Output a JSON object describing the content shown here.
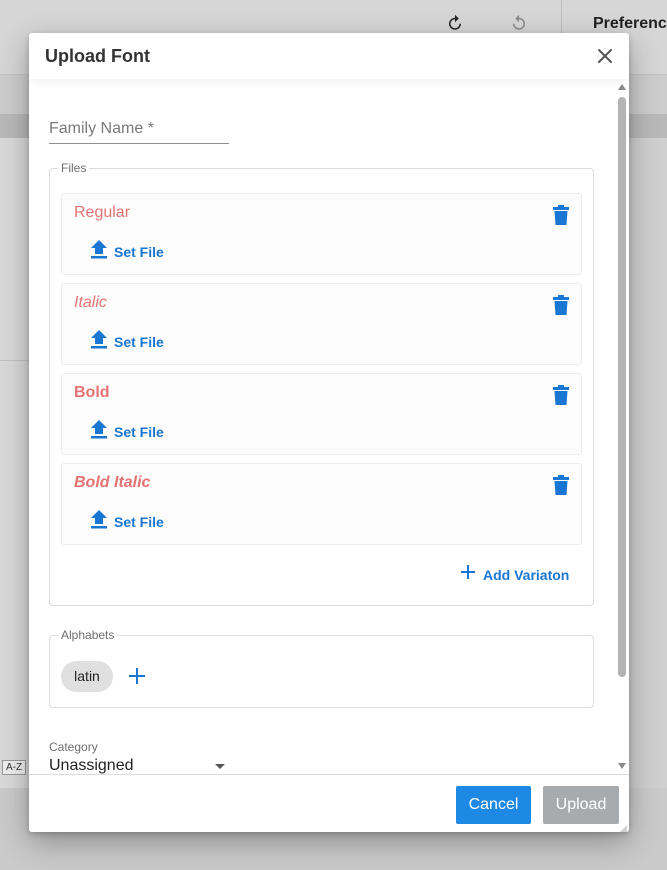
{
  "background": {
    "preferences_label": "Preference",
    "az_label": "A-Z",
    "icons": [
      "undo-icon",
      "redo-icon"
    ]
  },
  "dialog": {
    "title": "Upload Font",
    "family_name": {
      "label": "Family Name *",
      "value": ""
    },
    "files": {
      "legend": "Files",
      "variants": [
        {
          "label": "Regular",
          "style": "regular",
          "action": "Set File"
        },
        {
          "label": "Italic",
          "style": "italic",
          "action": "Set File"
        },
        {
          "label": "Bold",
          "style": "bold",
          "action": "Set File"
        },
        {
          "label": "Bold Italic",
          "style": "bold-italic",
          "action": "Set File"
        }
      ],
      "add_variation_label": "Add Variaton"
    },
    "alphabets": {
      "legend": "Alphabets",
      "chips": [
        "latin"
      ]
    },
    "category": {
      "label": "Category",
      "value": "Unassigned"
    },
    "buttons": {
      "cancel": "Cancel",
      "upload": "Upload"
    }
  },
  "colors": {
    "accent": "#1976d2",
    "variant_label": "#e57373",
    "primary_button": "#1e88e5",
    "disabled_button": "#a7abae"
  }
}
